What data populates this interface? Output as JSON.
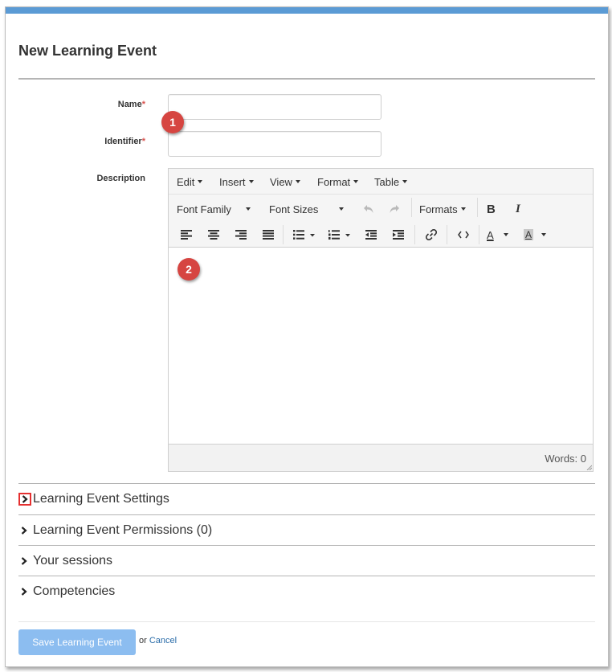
{
  "page": {
    "title": "New Learning Event"
  },
  "form": {
    "name_label": "Name",
    "identifier_label": "Identifier",
    "description_label": "Description",
    "required_mark": "*",
    "name_value": "",
    "identifier_value": ""
  },
  "markers": {
    "one": "1",
    "two": "2"
  },
  "editor": {
    "menus": [
      "Edit",
      "Insert",
      "View",
      "Format",
      "Table"
    ],
    "font_family": "Font Family",
    "font_sizes": "Font Sizes",
    "formats": "Formats",
    "bold": "B",
    "italic": "I",
    "text_color_glyph": "A",
    "bg_color_glyph": "A",
    "word_count": "Words: 0"
  },
  "sections": [
    {
      "label": "Learning Event Settings"
    },
    {
      "label": "Learning Event Permissions (0)"
    },
    {
      "label": "Your sessions"
    },
    {
      "label": "Competencies"
    }
  ],
  "footer": {
    "save_label": "Save Learning Event",
    "or_text": "or ",
    "cancel_label": "Cancel"
  },
  "colors": {
    "accent_bar": "#5b9bd5",
    "required": "#d9534f",
    "marker": "#d64541",
    "save_button": "#8cbdf0",
    "highlight_box": "#e53030",
    "link": "#2a6ca8"
  },
  "icons": [
    "undo-icon",
    "redo-icon",
    "align-left-icon",
    "align-center-icon",
    "align-right-icon",
    "align-justify-icon",
    "bullet-list-icon",
    "numbered-list-icon",
    "outdent-icon",
    "indent-icon",
    "link-icon",
    "code-icon",
    "text-color-icon",
    "background-color-icon",
    "chevron-right-icon",
    "resize-handle-icon"
  ]
}
